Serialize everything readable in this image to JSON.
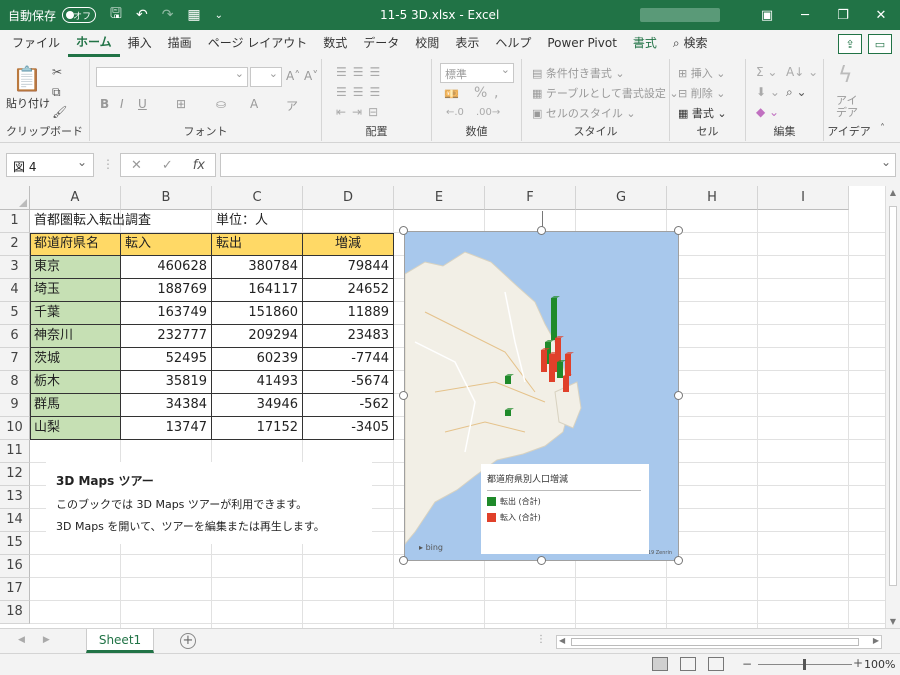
{
  "titlebar": {
    "autosave_label": "自動保存",
    "autosave_state": "オフ",
    "window_title": "11-5 3D.xlsx  -  Excel",
    "accent_color": "#217346"
  },
  "tabs": [
    "ファイル",
    "ホーム",
    "挿入",
    "描画",
    "ページ レイアウト",
    "数式",
    "データ",
    "校閲",
    "表示",
    "ヘルプ",
    "Power Pivot",
    "書式",
    "検索"
  ],
  "active_tab": "ホーム",
  "ribbon": {
    "clipboard": {
      "paste": "貼り付け",
      "label": "クリップボード"
    },
    "font": {
      "label": "フォント",
      "bold": "B",
      "italic": "I",
      "underline": "U"
    },
    "alignment": {
      "label": "配置"
    },
    "number": {
      "label": "数値",
      "format": "標準"
    },
    "styles": {
      "label": "スタイル",
      "conditional": "条件付き書式",
      "table": "テーブルとして書式設定",
      "cell_styles": "セルのスタイル"
    },
    "cells": {
      "label": "セル",
      "insert": "挿入",
      "delete": "削除",
      "format": "書式"
    },
    "editing": {
      "label": "編集"
    },
    "ideas": {
      "label": "アイデア",
      "button": "アイデア"
    }
  },
  "formula_bar": {
    "name_box": "図 4",
    "fx": "fx",
    "cancel": "✕",
    "enter": "✓",
    "value": ""
  },
  "columns": [
    "A",
    "B",
    "C",
    "D",
    "E",
    "F",
    "G",
    "H",
    "I"
  ],
  "rows": [
    "1",
    "2",
    "3",
    "4",
    "5",
    "6",
    "7",
    "8",
    "9",
    "10",
    "11",
    "12",
    "13",
    "14",
    "15",
    "16",
    "17",
    "18"
  ],
  "sheet": {
    "title": "首都圏転入転出調査",
    "unit": "単位：人",
    "headers": [
      "都道府県名",
      "転入",
      "転出",
      "増減"
    ],
    "data": [
      [
        "東京",
        "460628",
        "380784",
        "79844"
      ],
      [
        "埼玉",
        "188769",
        "164117",
        "24652"
      ],
      [
        "千葉",
        "163749",
        "151860",
        "11889"
      ],
      [
        "神奈川",
        "232777",
        "209294",
        "23483"
      ],
      [
        "茨城",
        "52495",
        "60239",
        "-7744"
      ],
      [
        "栃木",
        "35819",
        "41493",
        "-5674"
      ],
      [
        "群馬",
        "34384",
        "34946",
        "-562"
      ],
      [
        "山梨",
        "13747",
        "17152",
        "-3405"
      ]
    ]
  },
  "tour": {
    "title": "3D Maps ツアー",
    "line1": "このブックでは 3D Maps ツアーが利用できます。",
    "line2": "3D Maps を開いて、ツアーを編集または再生します。"
  },
  "map": {
    "legend_title": "都道府県別人口増減",
    "series": [
      {
        "name": "転出 (合計)",
        "color": "#1f8a2a"
      },
      {
        "name": "転入 (合計)",
        "color": "#e0402a"
      }
    ],
    "bing": "bing",
    "copyright": "© 2019 HERE  © 2019 Zenrin"
  },
  "sheet_tabs": [
    "Sheet1"
  ],
  "status": {
    "zoom": "100%"
  }
}
